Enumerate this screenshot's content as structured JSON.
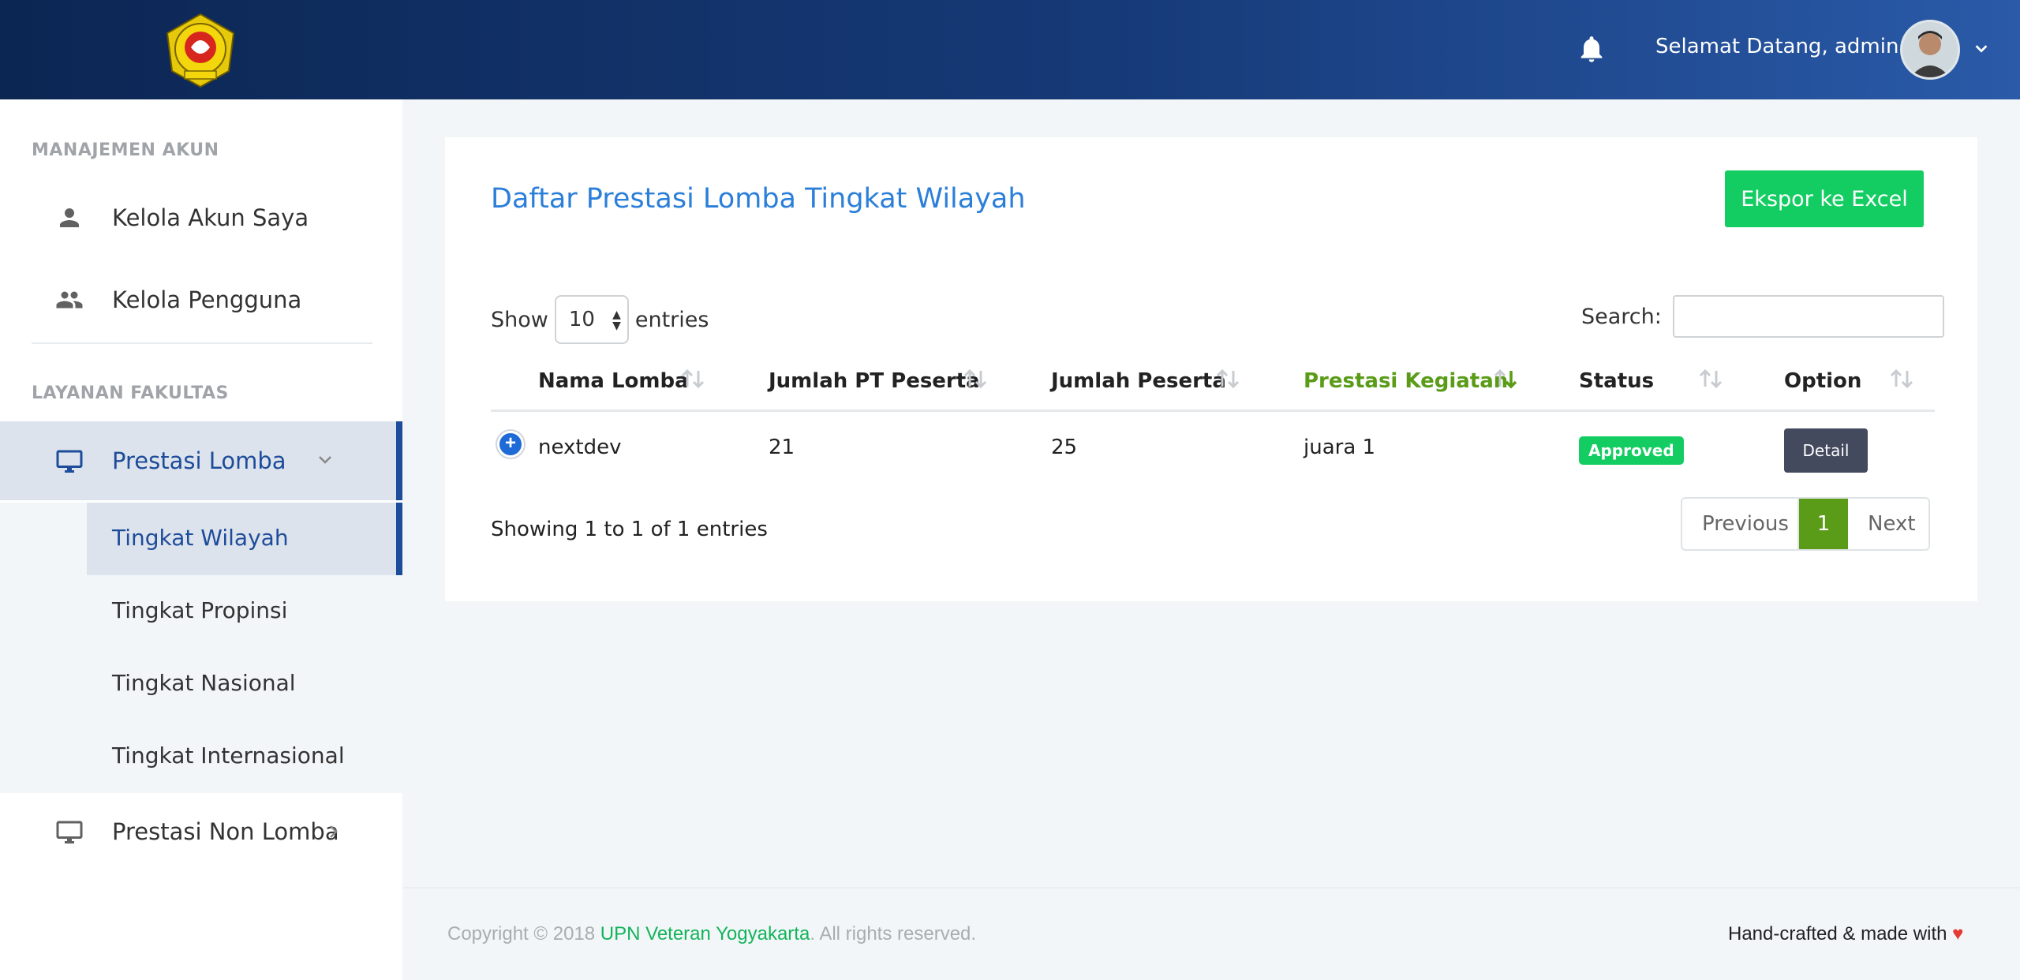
{
  "header": {
    "welcome_text": "Selamat Datang, admin"
  },
  "sidebar": {
    "section1_heading": "MANAJEMEN AKUN",
    "section2_heading": "LAYANAN FAKULTAS",
    "items": [
      {
        "label": "Kelola Akun Saya",
        "icon": "person-icon"
      },
      {
        "label": "Kelola Pengguna",
        "icon": "people-icon"
      },
      {
        "label": "Prestasi Lomba",
        "icon": "monitor-icon"
      },
      {
        "label": "Prestasi Non Lomba",
        "icon": "monitor-icon"
      }
    ],
    "submenu": [
      {
        "label": "Tingkat Wilayah"
      },
      {
        "label": "Tingkat Propinsi"
      },
      {
        "label": "Tingkat Nasional"
      },
      {
        "label": "Tingkat Internasional"
      }
    ]
  },
  "main": {
    "title": "Daftar Prestasi Lomba Tingkat Wilayah",
    "export_label": "Ekspor ke Excel",
    "show_label": "Show",
    "entries_label": "entries",
    "page_length": "10",
    "search_label": "Search:",
    "search_value": "",
    "columns": [
      "Nama Lomba",
      "Jumlah PT Peserta",
      "Jumlah Peserta",
      "Prestasi Kegiatan",
      "Status",
      "Option"
    ],
    "rows": [
      {
        "nama": "nextdev",
        "jumlah_pt": "21",
        "jumlah_peserta": "25",
        "prestasi": "juara 1",
        "status": "Approved",
        "option": "Detail"
      }
    ],
    "info": "Showing 1 to 1 of 1 entries",
    "pagination": {
      "previous": "Previous",
      "current": "1",
      "next": "Next"
    }
  },
  "footer": {
    "copyright_prefix": "Copyright © 2018 ",
    "copyright_link": "UPN Veteran Yogyakarta",
    "copyright_suffix": ". All rights reserved.",
    "handcrafted": "Hand-crafted & made with "
  },
  "colors": {
    "accent_blue": "#2b7fd9",
    "nav_dark": "#0c2653",
    "success_green": "#13cd62",
    "sorted_column": "#5a9b18"
  }
}
